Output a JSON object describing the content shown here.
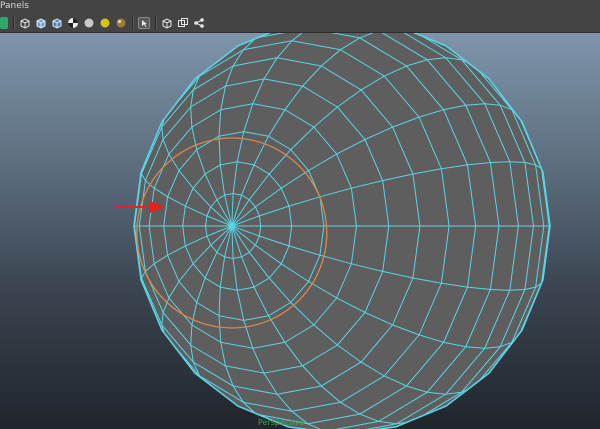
{
  "menubar": {
    "panels_label": "Panels"
  },
  "toolbar": {
    "icons": [
      "camera-icon",
      "wireframe-cube-icon",
      "shaded-cube-icon",
      "textured-cube-icon",
      "checker-icon",
      "light-bulb-icon",
      "sphere-light-icon",
      "shadow-sphere-icon",
      "isolate-select-icon",
      "xray-cube-icon",
      "multi-view-icon",
      "share-icon"
    ]
  },
  "viewport": {
    "panel_label": "Perspective",
    "colors": {
      "wireframe": "#5ad4e6",
      "selection": "#d98a4a",
      "sphere": "#5e5e5e",
      "arrow": "#e8201c"
    }
  }
}
